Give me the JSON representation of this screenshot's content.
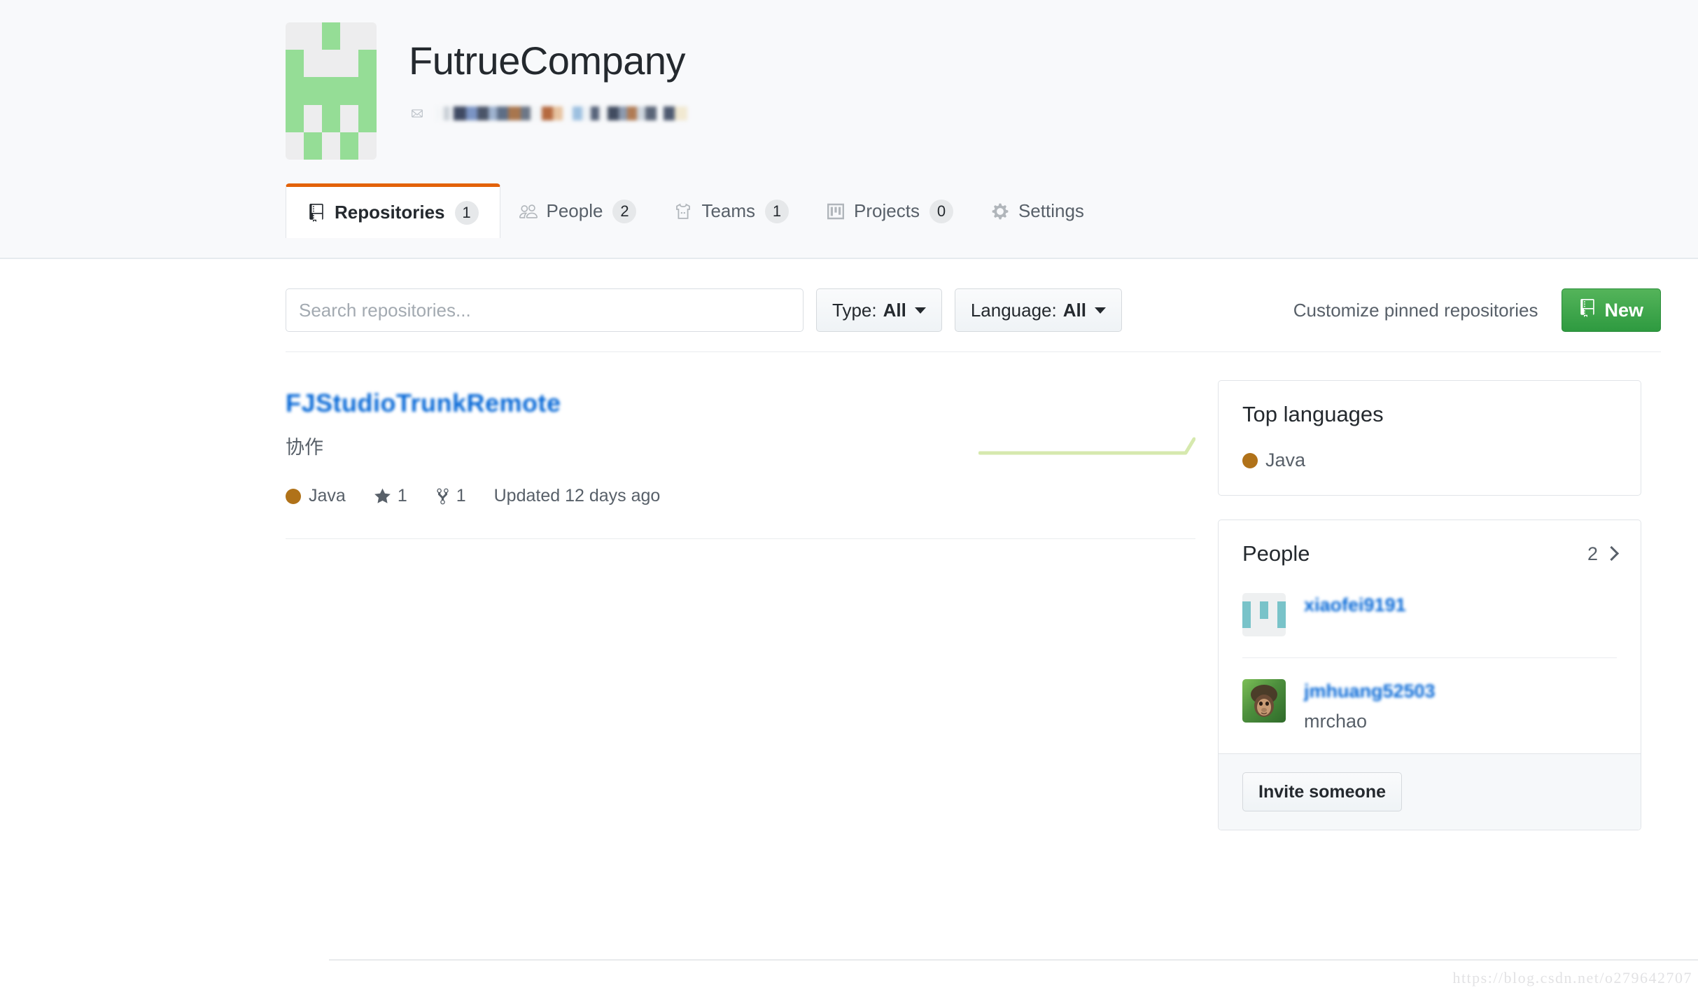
{
  "org": {
    "name": "FutrueCompany",
    "email_redacted": true,
    "mail_icon": "mail-icon",
    "avatar_icon": "organization-identicon",
    "avatar_color": "#95dd96",
    "avatar_bg": "#ededee",
    "avatar_grid": [
      [
        0,
        0,
        1,
        0,
        0
      ],
      [
        1,
        0,
        0,
        0,
        1
      ],
      [
        1,
        1,
        1,
        1,
        1
      ],
      [
        1,
        0,
        1,
        0,
        1
      ],
      [
        0,
        1,
        0,
        1,
        0
      ]
    ]
  },
  "tabs": [
    {
      "label": "Repositories",
      "count": "1",
      "icon": "repo-icon",
      "selected": true
    },
    {
      "label": "People",
      "count": "2",
      "icon": "people-icon",
      "selected": false
    },
    {
      "label": "Teams",
      "count": "1",
      "icon": "jersey-icon",
      "selected": false
    },
    {
      "label": "Projects",
      "count": "0",
      "icon": "project-board-icon",
      "selected": false
    },
    {
      "label": "Settings",
      "count": "",
      "icon": "gear-icon",
      "selected": false
    }
  ],
  "filters": {
    "search_placeholder": "Search repositories...",
    "search_value": "",
    "type": {
      "label": "Type:",
      "value": "All"
    },
    "language": {
      "label": "Language:",
      "value": "All"
    },
    "customize_link": "Customize pinned repositories",
    "new_button": "New",
    "new_button_icon": "repo-icon",
    "new_button_color": "#2e9a40"
  },
  "repositories": [
    {
      "name": "FJStudioTrunkRemote",
      "redacted": true,
      "description": "协作",
      "language": "Java",
      "language_color": "#b07219",
      "stars": "1",
      "forks": "1",
      "updated": "Updated 12 days ago",
      "star_icon": "star-icon",
      "fork_icon": "fork-icon",
      "sparkline_color": "#d6e9ae",
      "sparkline_points": [
        0,
        0,
        0,
        0,
        0,
        0,
        0,
        0,
        0,
        0,
        0,
        0,
        0,
        0,
        0,
        0,
        0,
        0,
        1
      ]
    }
  ],
  "sidebar": {
    "top_languages": {
      "title": "Top languages",
      "languages": [
        {
          "name": "Java",
          "color": "#b07219"
        }
      ]
    },
    "people": {
      "title": "People",
      "count": "2",
      "chevron_icon": "chevron-right-icon",
      "members": [
        {
          "login": "xiaofei9191",
          "login_redacted": true,
          "display_name": "",
          "avatar_type": "identicon",
          "avatar_color": "#79c3c9",
          "avatar_grid": [
            [
              0,
              0,
              0,
              0,
              0
            ],
            [
              1,
              0,
              1,
              0,
              1
            ],
            [
              1,
              0,
              1,
              0,
              1
            ],
            [
              1,
              0,
              0,
              0,
              1
            ],
            [
              0,
              0,
              0,
              0,
              0
            ]
          ]
        },
        {
          "login": "jmhuang52503",
          "login_redacted": true,
          "display_name": "mrchao",
          "avatar_type": "photo",
          "avatar_alt": "orangutan-avatar"
        }
      ],
      "invite_button": "Invite someone"
    }
  },
  "watermark": "https://blog.csdn.net/o279642707"
}
